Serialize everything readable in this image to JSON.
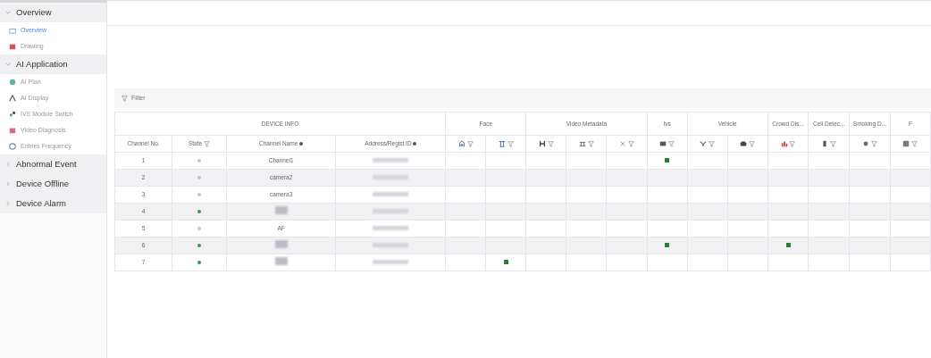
{
  "sidebar": {
    "groups": [
      {
        "label": "Overview",
        "expanded": true,
        "items": [
          {
            "label": "Overview",
            "selected": true
          },
          {
            "label": "Drawing",
            "selected": false
          }
        ]
      },
      {
        "label": "AI Application",
        "expanded": true,
        "items": [
          {
            "label": "AI Plan",
            "selected": false
          },
          {
            "label": "AI Display",
            "selected": false
          },
          {
            "label": "IVS Module Switch",
            "selected": false
          },
          {
            "label": "Video Diagnosis",
            "selected": false
          },
          {
            "label": "Entries Frequency",
            "selected": false
          }
        ]
      },
      {
        "label": "Abnormal Event",
        "expanded": false
      },
      {
        "label": "Device Offline",
        "expanded": false
      },
      {
        "label": "Device Alarm",
        "expanded": false
      }
    ]
  },
  "filter": {
    "label": "Filter"
  },
  "table": {
    "info_group": "DEVICE INFO",
    "info_columns": [
      "Channel No.",
      "State",
      "Channel Name",
      "Address/Regist ID"
    ],
    "groups": [
      "Face",
      "Video Metadata",
      "Ivs",
      "Vehicle",
      "Crowd Dis...",
      "Cell Detec...",
      "Smoking D...",
      "F"
    ],
    "rows": [
      {
        "channel_no": "1",
        "online": false,
        "name": "Channel1",
        "detections": [
          false,
          false,
          false,
          false,
          false,
          true,
          false,
          false,
          false,
          false,
          false,
          false
        ]
      },
      {
        "channel_no": "2",
        "online": false,
        "name": "camera2",
        "detections": [
          false,
          false,
          false,
          false,
          false,
          false,
          false,
          false,
          false,
          false,
          false,
          false
        ]
      },
      {
        "channel_no": "3",
        "online": false,
        "name": "camera3",
        "detections": [
          false,
          false,
          false,
          false,
          false,
          false,
          false,
          false,
          false,
          false,
          false,
          false
        ]
      },
      {
        "channel_no": "4",
        "online": true,
        "detections": [
          false,
          false,
          false,
          false,
          false,
          false,
          false,
          false,
          false,
          false,
          false,
          false
        ]
      },
      {
        "channel_no": "5",
        "online": false,
        "name": "AF",
        "detections": [
          false,
          false,
          false,
          false,
          false,
          false,
          false,
          false,
          false,
          false,
          false,
          false
        ]
      },
      {
        "channel_no": "6",
        "online": true,
        "detections": [
          false,
          false,
          false,
          false,
          false,
          true,
          false,
          false,
          true,
          false,
          false,
          false
        ]
      },
      {
        "channel_no": "7",
        "online": true,
        "detections": [
          false,
          true,
          false,
          false,
          false,
          false,
          false,
          false,
          false,
          false,
          false,
          false
        ]
      }
    ]
  }
}
